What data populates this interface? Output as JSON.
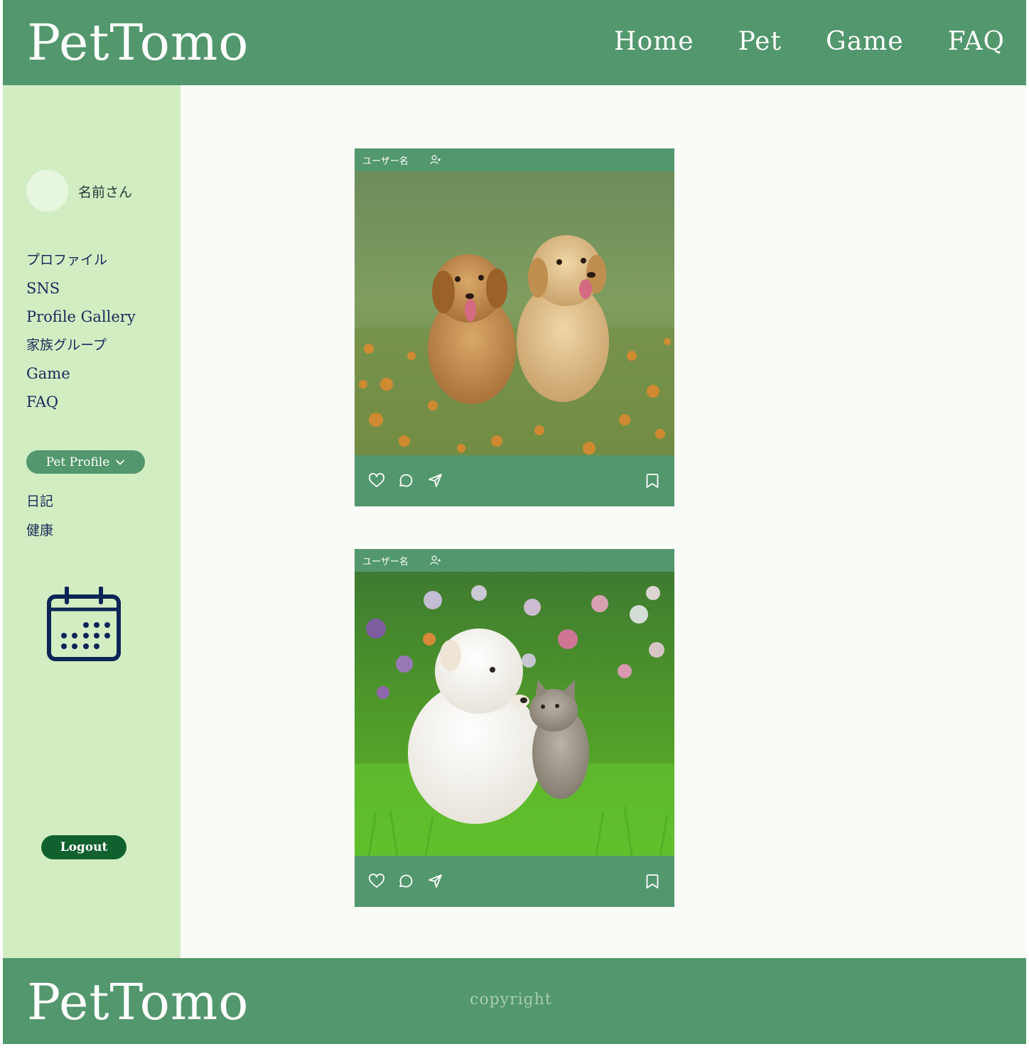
{
  "app": {
    "brand": "PetTomo"
  },
  "nav": {
    "items": [
      "Home",
      "Pet",
      "Game",
      "FAQ"
    ]
  },
  "sidebar": {
    "username": "名前さん",
    "menu": [
      "プロファイル",
      "SNS",
      "Profile Gallery",
      "家族グループ",
      "Game",
      "FAQ"
    ],
    "pet_profile_label": "Pet Profile",
    "submenu": [
      "日記",
      "健康"
    ],
    "logout_label": "Logout"
  },
  "posts": [
    {
      "user": "ユーザー名",
      "photo": "two golden retriever puppies in flower field"
    },
    {
      "user": "ユーザー名",
      "photo": "white puppy and tabby kitten on grass"
    }
  ],
  "footer": {
    "brand": "PetTomo",
    "copyright": "copyright"
  },
  "colors": {
    "header": "#52976d",
    "sidebar": "#d3edc3",
    "content_bg": "#f9fbf7",
    "menu_text": "#162b5a",
    "logout": "#11612f",
    "calendar": "#0c2556"
  },
  "icons": [
    "user-plus-icon",
    "heart-icon",
    "comment-icon",
    "send-icon",
    "bookmark-icon",
    "chevron-down-icon",
    "calendar-icon"
  ]
}
